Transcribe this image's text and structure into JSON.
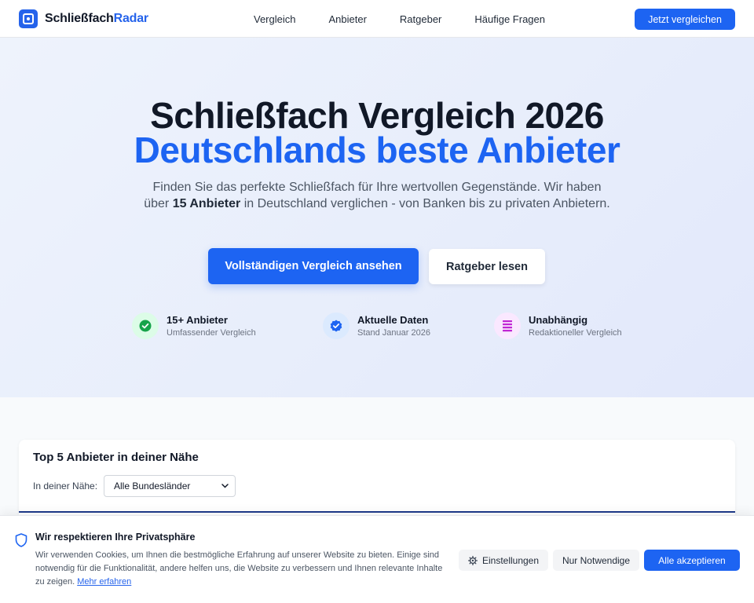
{
  "nav": {
    "brand_part1": "Schließfach",
    "brand_part2": "Radar",
    "links": [
      "Vergleich",
      "Anbieter",
      "Ratgeber",
      "Häufige Fragen"
    ],
    "cta": "Jetzt vergleichen"
  },
  "hero": {
    "title_line1": "Schließfach Vergleich 2026",
    "title_line2": "Deutschlands beste Anbieter",
    "lead_before": "Finden Sie das perfekte Schließfach für Ihre wertvollen Gegenstände. Wir haben über ",
    "lead_bold": "15 Anbieter",
    "lead_after": " in Deutschland verglichen - von Banken bis zu privaten Anbietern.",
    "primary_button": "Vollständigen Vergleich ansehen",
    "secondary_button": "Ratgeber lesen",
    "features": [
      {
        "title": "15+ Anbieter",
        "subtitle": "Umfassender Vergleich",
        "icon": "check-circle-icon",
        "color": "#16a34a"
      },
      {
        "title": "Aktuelle Daten",
        "subtitle": "Stand Januar 2026",
        "icon": "verified-badge-icon",
        "color": "#1d64f2"
      },
      {
        "title": "Unabhängig",
        "subtitle": "Redaktioneller Vergleich",
        "icon": "document-lines-icon",
        "color": "#c026d3"
      }
    ]
  },
  "top5": {
    "title": "Top 5 Anbieter in deiner Nähe",
    "filter_label": "In deiner Nähe:",
    "filter_value": "Alle Bundesländer"
  },
  "cookie": {
    "title": "Wir respektieren Ihre Privatsphäre",
    "text": "Wir verwenden Cookies, um Ihnen die bestmögliche Erfahrung auf unserer Website zu bieten. Einige sind notwendig für die Funktionalität, andere helfen uns, die Website zu verbessern und Ihnen relevante Inhalte zu zeigen. ",
    "link": "Mehr erfahren",
    "settings_button": "Einstellungen",
    "essential_button": "Nur Notwendige",
    "accept_button": "Alle akzeptieren"
  },
  "colors": {
    "accent": "#1d64f2",
    "text": "#111827",
    "muted": "#4b5563"
  }
}
